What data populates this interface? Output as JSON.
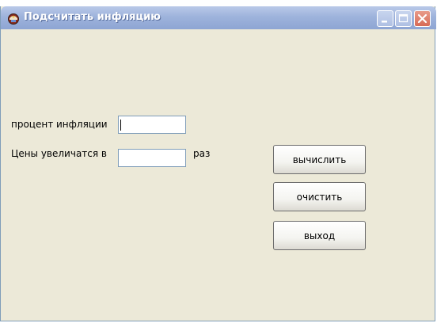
{
  "window": {
    "title": "Подсчитать инфляцию",
    "icon": "app-icon"
  },
  "titlebar_buttons": {
    "minimize": "minimize-icon",
    "maximize": "maximize-icon",
    "close": "close-icon"
  },
  "form": {
    "percent_label": "процент инфляции",
    "percent_value": "",
    "prices_label": "Цены увеличатся в",
    "result_value": "",
    "times_label": "раз"
  },
  "buttons": {
    "calculate": "вычислить",
    "clear": "очистить",
    "exit": "выход"
  },
  "colors": {
    "window_bg": "#ece9d8",
    "titlebar": "#9eb3dc",
    "close_button": "#d76a55"
  }
}
